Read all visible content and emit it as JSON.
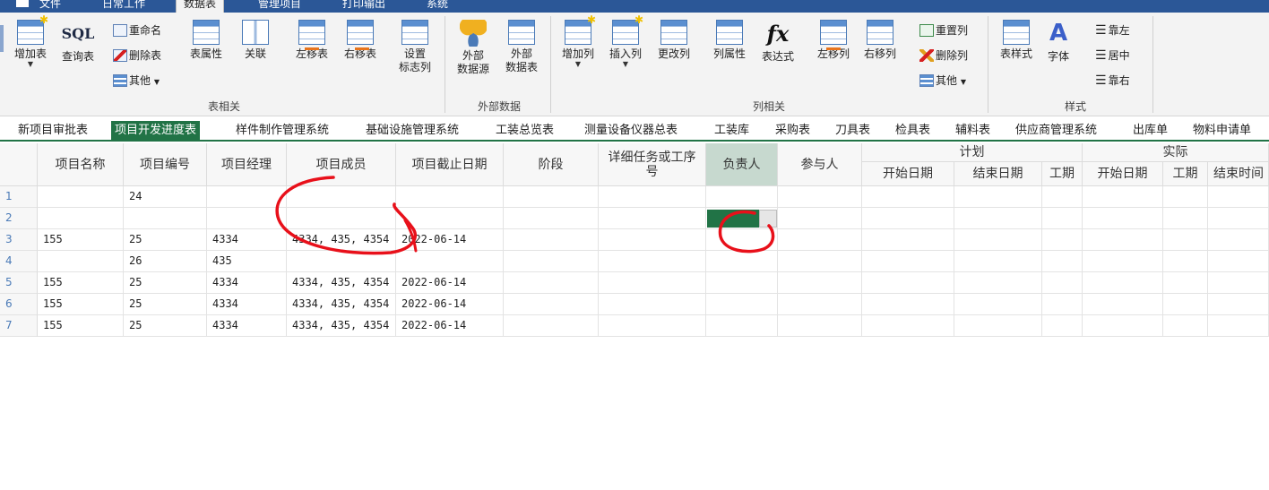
{
  "menu": {
    "items": [
      "文件",
      "日常工作",
      "数据表",
      "管理项目",
      "打印输出",
      "系统"
    ],
    "active": "数据表"
  },
  "ribbon": {
    "group_table": {
      "label": "表相关",
      "add_table": "增加表",
      "sql_icon_text": "SQL",
      "query_table": "查询表",
      "rename": "重命名",
      "delete_table": "删除表",
      "other": "其他",
      "table_props": "表属性",
      "relate": "关联",
      "move_left": "左移表",
      "move_right": "右移表",
      "set_flag_col": [
        "设置",
        "标志列"
      ]
    },
    "group_external": {
      "label": "外部数据",
      "ext_source": [
        "外部",
        "数据源"
      ],
      "ext_table": [
        "外部",
        "数据表"
      ]
    },
    "group_column": {
      "label": "列相关",
      "add_col": "增加列",
      "insert_col": "插入列",
      "change_col": "更改列",
      "col_props": "列属性",
      "fx_icon_text": "fx",
      "expression": "表达式",
      "col_left": "左移列",
      "col_right": "右移列",
      "reset_col": "重置列",
      "delete_col": "删除列",
      "other": "其他"
    },
    "group_style": {
      "label": "样式",
      "table_style": "表样式",
      "font": "字体",
      "align_left": "靠左",
      "align_center": "居中",
      "align_right": "靠右"
    }
  },
  "tabs": [
    "新项目审批表",
    "项目开发进度表",
    "样件制作管理系统",
    "基础设施管理系统",
    "工装总览表",
    "测量设备仪器总表",
    "工装库",
    "采购表",
    "刀具表",
    "检具表",
    "辅料表",
    "供应商管理系统",
    "出库单",
    "物料申请单"
  ],
  "active_tab": "项目开发进度表",
  "grid": {
    "headers": [
      "项目名称",
      "项目编号",
      "项目经理",
      "项目成员",
      "项目截止日期",
      "阶段",
      "详细任务或工序号",
      "负责人",
      "参与人"
    ],
    "plan_group": "计划",
    "plan_sub": [
      "开始日期",
      "结束日期",
      "工期"
    ],
    "actual_group": "实际",
    "actual_sub": [
      "开始日期",
      "工期",
      "结束时间"
    ],
    "row_numbers": [
      "1",
      "2",
      "3",
      "4",
      "5",
      "6",
      "7"
    ],
    "rows": [
      [
        "",
        "24",
        "",
        "",
        ""
      ],
      [
        "",
        "",
        "",
        "",
        ""
      ],
      [
        "155",
        "25",
        "4334",
        "4334, 435, 4354",
        "2022-06-14"
      ],
      [
        "",
        "26",
        "435",
        "",
        ""
      ],
      [
        "155",
        "25",
        "4334",
        "4334, 435, 4354",
        "2022-06-14"
      ],
      [
        "155",
        "25",
        "4334",
        "4334, 435, 4354",
        "2022-06-14"
      ],
      [
        "155",
        "25",
        "4334",
        "4334, 435, 4354",
        "2022-06-14"
      ]
    ]
  },
  "colors": {
    "accent": "#217346",
    "annotation": "#e8101a",
    "menubar": "#2b5797"
  }
}
